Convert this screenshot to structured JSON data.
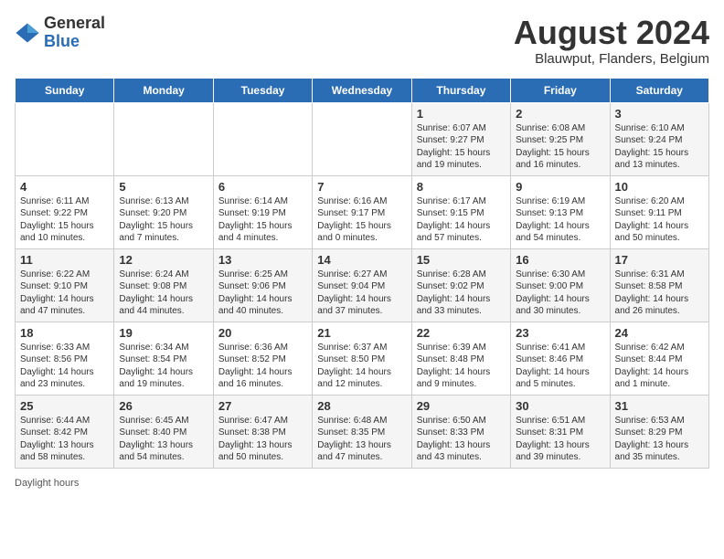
{
  "header": {
    "logo_general": "General",
    "logo_blue": "Blue",
    "main_title": "August 2024",
    "subtitle": "Blauwput, Flanders, Belgium"
  },
  "days_of_week": [
    "Sunday",
    "Monday",
    "Tuesday",
    "Wednesday",
    "Thursday",
    "Friday",
    "Saturday"
  ],
  "footer_label": "Daylight hours",
  "weeks": [
    [
      {
        "day": "",
        "info": ""
      },
      {
        "day": "",
        "info": ""
      },
      {
        "day": "",
        "info": ""
      },
      {
        "day": "",
        "info": ""
      },
      {
        "day": "1",
        "info": "Sunrise: 6:07 AM\nSunset: 9:27 PM\nDaylight: 15 hours and 19 minutes."
      },
      {
        "day": "2",
        "info": "Sunrise: 6:08 AM\nSunset: 9:25 PM\nDaylight: 15 hours and 16 minutes."
      },
      {
        "day": "3",
        "info": "Sunrise: 6:10 AM\nSunset: 9:24 PM\nDaylight: 15 hours and 13 minutes."
      }
    ],
    [
      {
        "day": "4",
        "info": "Sunrise: 6:11 AM\nSunset: 9:22 PM\nDaylight: 15 hours and 10 minutes."
      },
      {
        "day": "5",
        "info": "Sunrise: 6:13 AM\nSunset: 9:20 PM\nDaylight: 15 hours and 7 minutes."
      },
      {
        "day": "6",
        "info": "Sunrise: 6:14 AM\nSunset: 9:19 PM\nDaylight: 15 hours and 4 minutes."
      },
      {
        "day": "7",
        "info": "Sunrise: 6:16 AM\nSunset: 9:17 PM\nDaylight: 15 hours and 0 minutes."
      },
      {
        "day": "8",
        "info": "Sunrise: 6:17 AM\nSunset: 9:15 PM\nDaylight: 14 hours and 57 minutes."
      },
      {
        "day": "9",
        "info": "Sunrise: 6:19 AM\nSunset: 9:13 PM\nDaylight: 14 hours and 54 minutes."
      },
      {
        "day": "10",
        "info": "Sunrise: 6:20 AM\nSunset: 9:11 PM\nDaylight: 14 hours and 50 minutes."
      }
    ],
    [
      {
        "day": "11",
        "info": "Sunrise: 6:22 AM\nSunset: 9:10 PM\nDaylight: 14 hours and 47 minutes."
      },
      {
        "day": "12",
        "info": "Sunrise: 6:24 AM\nSunset: 9:08 PM\nDaylight: 14 hours and 44 minutes."
      },
      {
        "day": "13",
        "info": "Sunrise: 6:25 AM\nSunset: 9:06 PM\nDaylight: 14 hours and 40 minutes."
      },
      {
        "day": "14",
        "info": "Sunrise: 6:27 AM\nSunset: 9:04 PM\nDaylight: 14 hours and 37 minutes."
      },
      {
        "day": "15",
        "info": "Sunrise: 6:28 AM\nSunset: 9:02 PM\nDaylight: 14 hours and 33 minutes."
      },
      {
        "day": "16",
        "info": "Sunrise: 6:30 AM\nSunset: 9:00 PM\nDaylight: 14 hours and 30 minutes."
      },
      {
        "day": "17",
        "info": "Sunrise: 6:31 AM\nSunset: 8:58 PM\nDaylight: 14 hours and 26 minutes."
      }
    ],
    [
      {
        "day": "18",
        "info": "Sunrise: 6:33 AM\nSunset: 8:56 PM\nDaylight: 14 hours and 23 minutes."
      },
      {
        "day": "19",
        "info": "Sunrise: 6:34 AM\nSunset: 8:54 PM\nDaylight: 14 hours and 19 minutes."
      },
      {
        "day": "20",
        "info": "Sunrise: 6:36 AM\nSunset: 8:52 PM\nDaylight: 14 hours and 16 minutes."
      },
      {
        "day": "21",
        "info": "Sunrise: 6:37 AM\nSunset: 8:50 PM\nDaylight: 14 hours and 12 minutes."
      },
      {
        "day": "22",
        "info": "Sunrise: 6:39 AM\nSunset: 8:48 PM\nDaylight: 14 hours and 9 minutes."
      },
      {
        "day": "23",
        "info": "Sunrise: 6:41 AM\nSunset: 8:46 PM\nDaylight: 14 hours and 5 minutes."
      },
      {
        "day": "24",
        "info": "Sunrise: 6:42 AM\nSunset: 8:44 PM\nDaylight: 14 hours and 1 minute."
      }
    ],
    [
      {
        "day": "25",
        "info": "Sunrise: 6:44 AM\nSunset: 8:42 PM\nDaylight: 13 hours and 58 minutes."
      },
      {
        "day": "26",
        "info": "Sunrise: 6:45 AM\nSunset: 8:40 PM\nDaylight: 13 hours and 54 minutes."
      },
      {
        "day": "27",
        "info": "Sunrise: 6:47 AM\nSunset: 8:38 PM\nDaylight: 13 hours and 50 minutes."
      },
      {
        "day": "28",
        "info": "Sunrise: 6:48 AM\nSunset: 8:35 PM\nDaylight: 13 hours and 47 minutes."
      },
      {
        "day": "29",
        "info": "Sunrise: 6:50 AM\nSunset: 8:33 PM\nDaylight: 13 hours and 43 minutes."
      },
      {
        "day": "30",
        "info": "Sunrise: 6:51 AM\nSunset: 8:31 PM\nDaylight: 13 hours and 39 minutes."
      },
      {
        "day": "31",
        "info": "Sunrise: 6:53 AM\nSunset: 8:29 PM\nDaylight: 13 hours and 35 minutes."
      }
    ]
  ]
}
